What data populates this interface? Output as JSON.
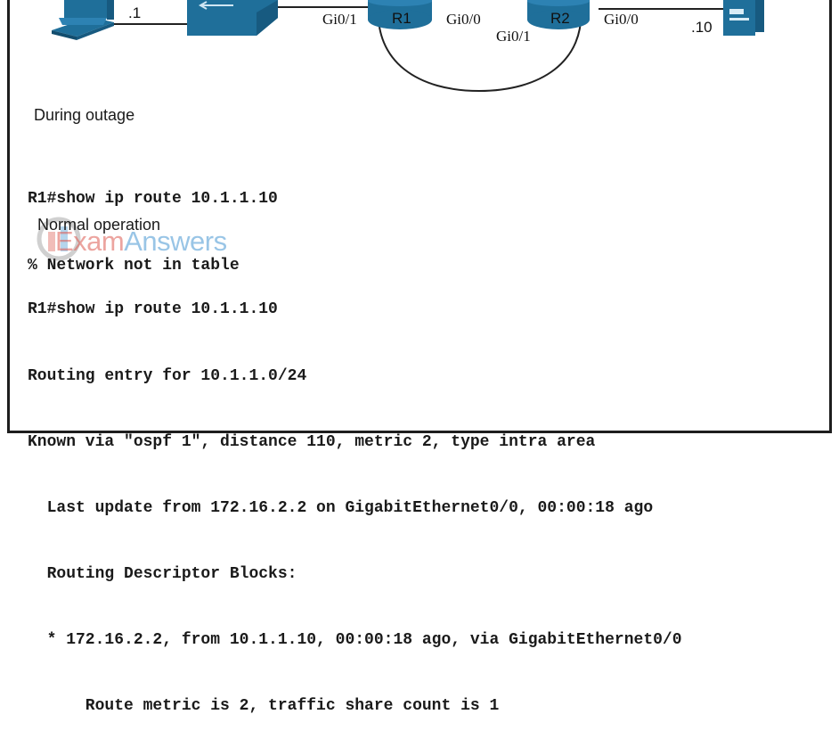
{
  "topology": {
    "pc_label": ".1",
    "r1_label": "R1",
    "r2_label": "R2",
    "r1_left_if": "Gi0/1",
    "r1_right_if": "Gi0/0",
    "r2_left_if": "Gi0/1",
    "r2_right_if": "Gi0/0",
    "server_label": ".10"
  },
  "outage": {
    "title": "During outage",
    "lines": [
      "R1#show ip route 10.1.1.10",
      "% Network not in table"
    ]
  },
  "normal": {
    "title": "Normal operation",
    "lines": [
      "R1#show ip route 10.1.1.10",
      "Routing entry for 10.1.1.0/24",
      "Known via \"ospf 1\", distance 110, metric 2, type intra area",
      "  Last update from 172.16.2.2 on GigabitEthernet0/0, 00:00:18 ago",
      "  Routing Descriptor Blocks:",
      "  * 172.16.2.2, from 10.1.1.10, 00:00:18 ago, via GigabitEthernet0/0",
      "      Route metric is 2, traffic share count is 1"
    ]
  },
  "watermark": {
    "part1": "Exam",
    "part2": "Answers"
  },
  "colors": {
    "device_blue": "#1f6f9a",
    "frame": "#1e1e1e",
    "text": "#1a1a1a"
  }
}
